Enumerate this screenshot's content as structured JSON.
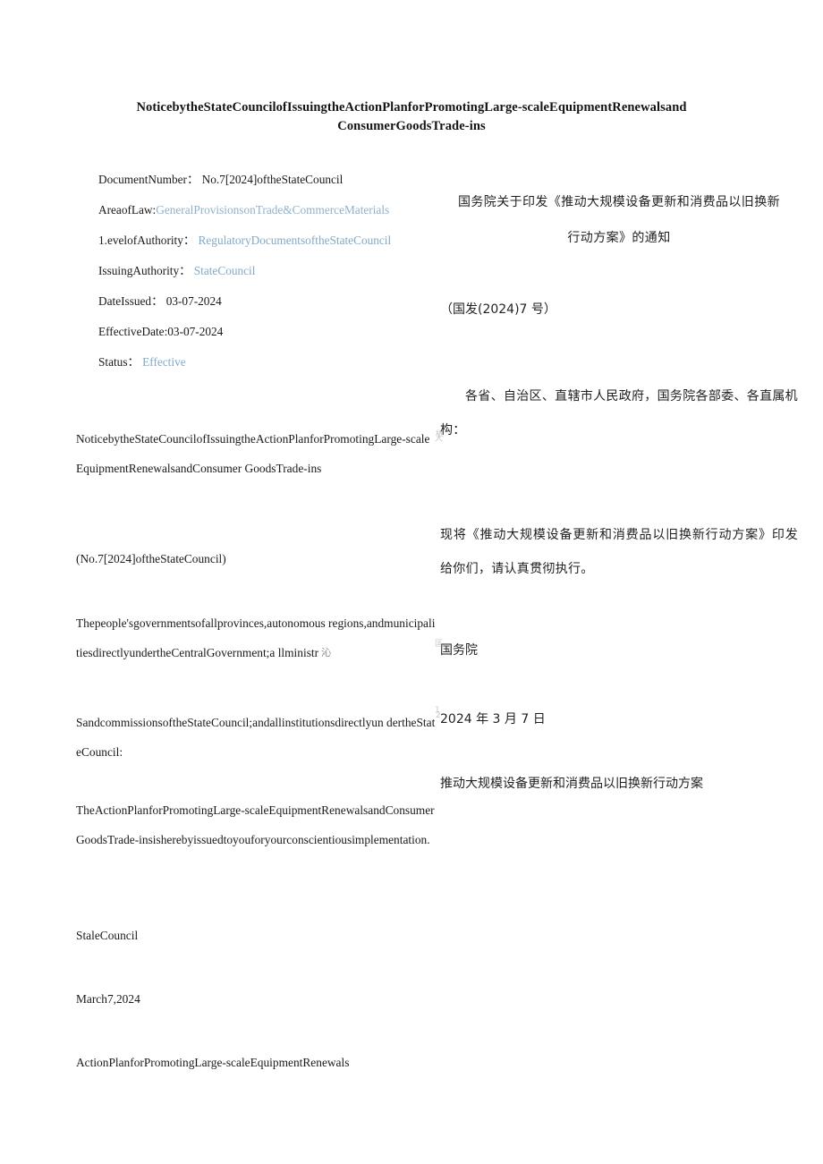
{
  "document": {
    "title_line_1": "NoticebytheStateCouncilofIssuingtheActionPlanforPromotingLarge-scaleEquipmentRenewalsand",
    "title_line_2": "ConsumerGoodsTrade-ins"
  },
  "colors": {
    "link": "#8fb2cc",
    "text": "#1a1a1a",
    "background": "#ffffff"
  },
  "metadata": [
    {
      "label": "DocumentNumber：",
      "value": "No.7[2024]oftheStateCouncil",
      "is_link": false
    },
    {
      "label": "AreaofLaw:",
      "value": "GeneralProvisionsonTrade&CommerceMaterials",
      "is_link": true
    },
    {
      "label": "1.evelofAuthority：",
      "value": "RegulatoryDocumentsoftheStateCouncil",
      "is_link": true
    },
    {
      "label": "IssuingAuthority：",
      "value": "StateCouncil",
      "is_link": true
    },
    {
      "label": "DateIssued：",
      "value": "03-07-2024",
      "is_link": false
    },
    {
      "label": "EffectiveDate:",
      "value": "03-07-2024",
      "is_link": false
    },
    {
      "label": "Status：",
      "value": "Effective",
      "is_link": true
    }
  ],
  "english_body": {
    "heading": "NoticebytheStateCouncilofIssuingtheActionPlanforPromotingLarge-scaleEquipmentRenewalsandConsumer GoodsTrade-ins",
    "doc_number": "(No.7[2024]oftheStateCouncil)",
    "addressee_part_1": "Thepeople'sgovernmentsofallprovinces,autonomous regions,andmunicipalitiesdirectlyundertheCentralGovernment;a llministr",
    "addressee_artifact": "沁",
    "addressee_part_2": "SandcommissionsoftheStateCouncil;andallinstitutionsdirectlyun dertheStateCouncil:",
    "issuance_paragraph": "TheActionPlanforPromotingLarge-scaleEquipmentRenewalsandConsumerGoodsTrade-insisherebyissuedtoyouforyourconscientiousimplementation.",
    "signature_authority": "StaleCouncil",
    "signature_date": "March7,2024",
    "attachment_title": "ActionPlanforPromotingLarge-scaleEquipmentRenewals"
  },
  "chinese_body": {
    "title_line_1": "国务院关于印发《推动大规模设备更新和消费品以旧换新",
    "title_line_2": "行动方案》的通知",
    "doc_number": "（国发(2024)7 号）",
    "addressee": "各省、自治区、直辖市人民政府，国务院各部委、各直属机构：",
    "issuance_paragraph": "现将《推动大规模设备更新和消费品以旧换新行动方案》印发给你们，请认真贯彻执行。",
    "signature_authority": "国务院",
    "signature_date": "2024 年 3 月 7 日",
    "attachment_title": "推动大规模设备更新和消费品以旧换新行动方案"
  },
  "scan_artifacts": {
    "mark_a": "枨",
    "mark_b": "匡",
    "mark_c": "2",
    "mark_d": "人",
    "mark_e": "1"
  }
}
